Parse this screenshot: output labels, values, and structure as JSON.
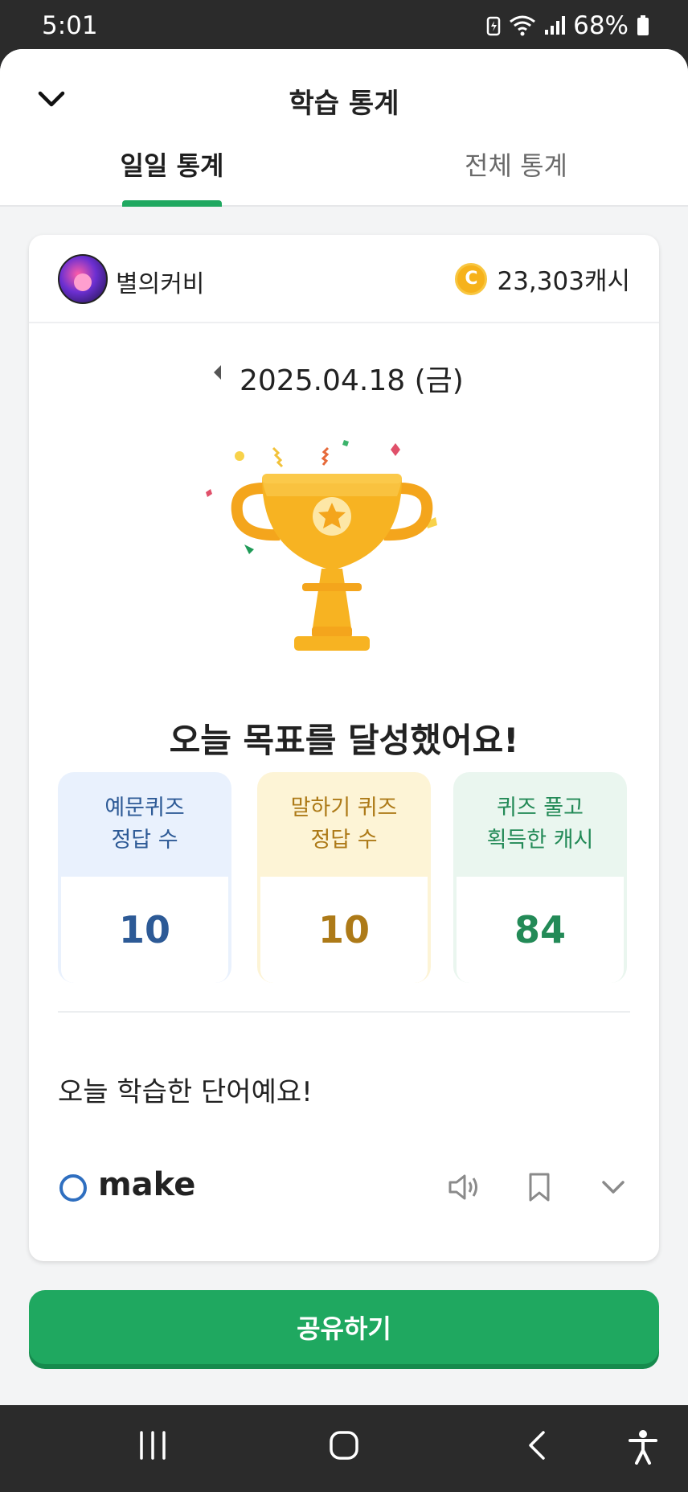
{
  "status_bar": {
    "time": "5:01",
    "battery": "68%",
    "icons": [
      "battery-saver-icon",
      "wifi-icon",
      "signal-icon",
      "battery-icon"
    ]
  },
  "header": {
    "title": "학습 통계",
    "collapse_icon": "chevron-down-icon",
    "tabs": [
      {
        "label": "일일 통계",
        "active": true
      },
      {
        "label": "전체 통계",
        "active": false
      }
    ]
  },
  "profile": {
    "username": "별의커비",
    "cash": "23,303캐시",
    "coin_symbol": "C"
  },
  "date": {
    "text": "2025.04.18 (금)",
    "prev_icon": "caret-left-icon"
  },
  "goal_message": "오늘 목표를 달성했어요!",
  "stats": [
    {
      "label_line1": "예문퀴즈",
      "label_line2": "정답 수",
      "value": "10",
      "color": "#2d5a96"
    },
    {
      "label_line1": "말하기 퀴즈",
      "label_line2": "정답 수",
      "value": "10",
      "color": "#ad7a18"
    },
    {
      "label_line1": "퀴즈 풀고",
      "label_line2": "획득한 캐시",
      "value": "84",
      "color": "#238a57"
    }
  ],
  "words_section": {
    "title": "오늘 학습한 단어예요!",
    "words": [
      {
        "word": "make",
        "mark": "circle"
      }
    ]
  },
  "share_button": "공유하기",
  "colors": {
    "accent_green": "#1fa860",
    "trophy": "#f6b21b"
  },
  "nav_bar": {
    "buttons": [
      "recents-icon",
      "home-icon",
      "back-icon",
      "accessibility-icon"
    ]
  }
}
